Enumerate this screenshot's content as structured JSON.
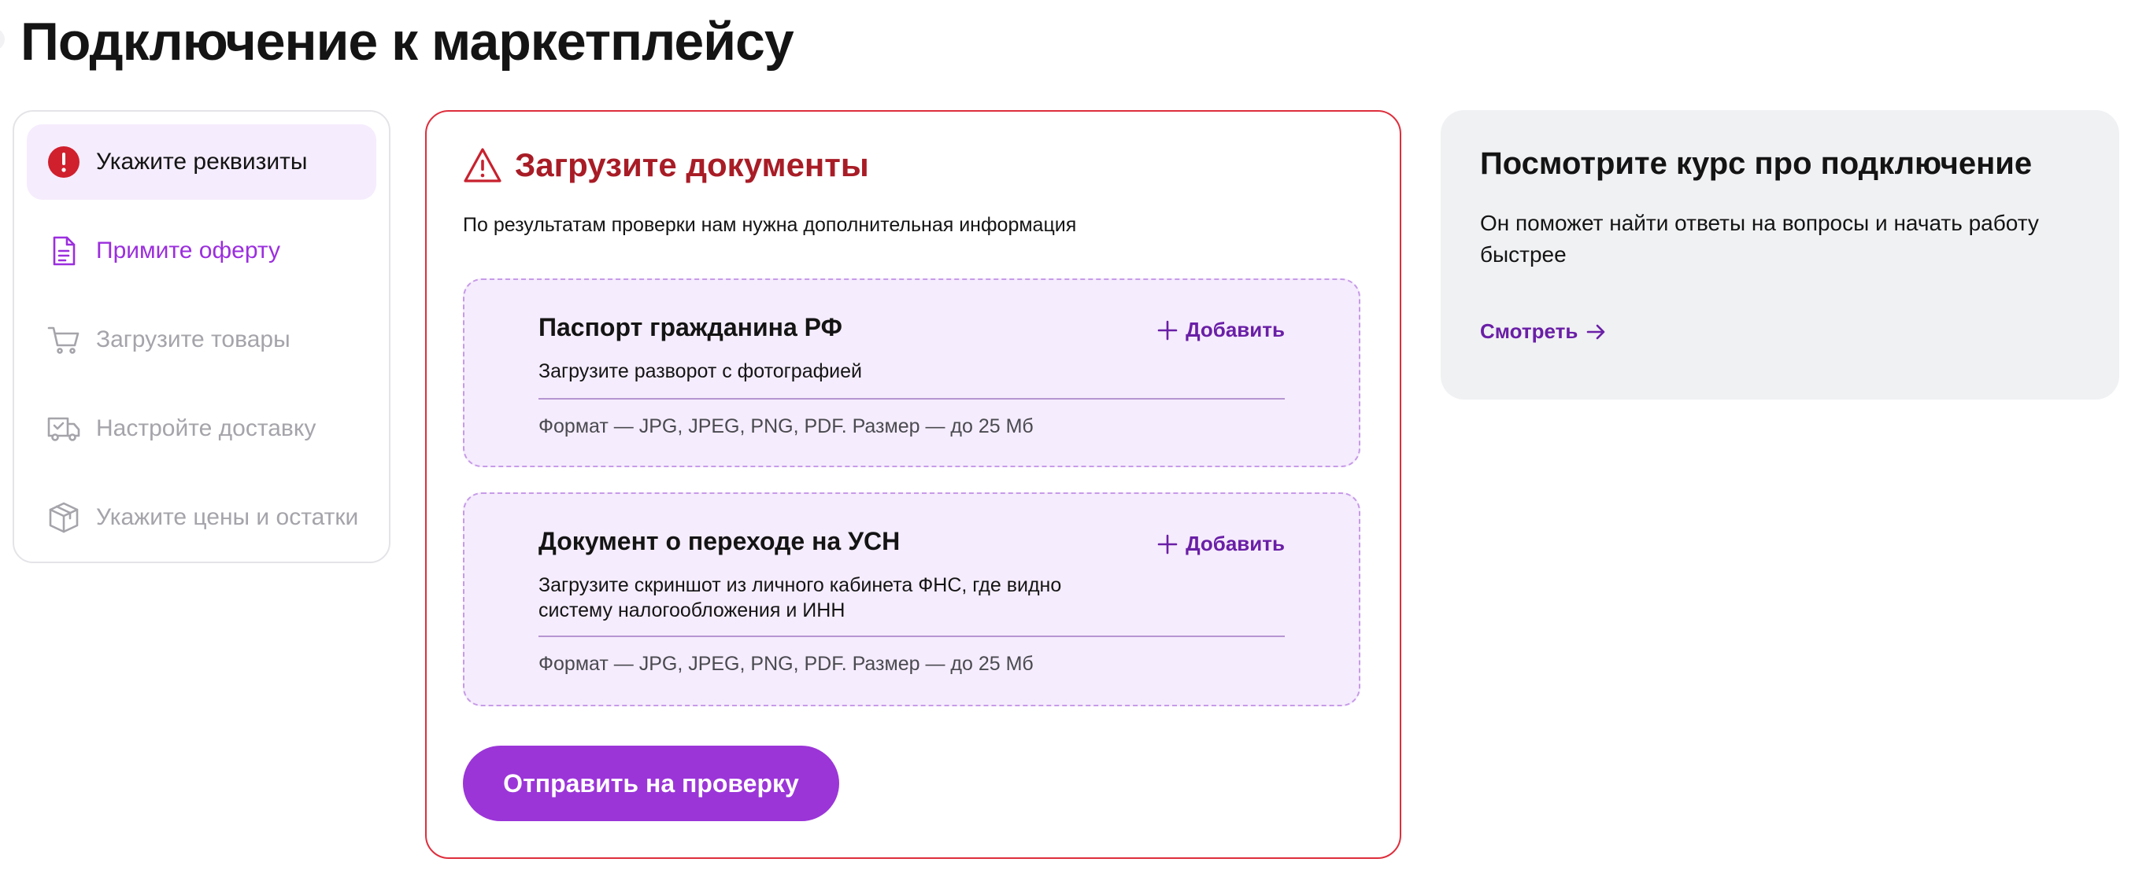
{
  "page": {
    "title": "Подключение к маркетплейсу"
  },
  "steps": [
    {
      "label": "Укажите реквизиты",
      "state": "error",
      "icon": "error-icon"
    },
    {
      "label": "Примите оферту",
      "state": "current",
      "icon": "document-icon"
    },
    {
      "label": "Загрузите товары",
      "state": "disabled",
      "icon": "cart-icon"
    },
    {
      "label": "Настройте доставку",
      "state": "disabled",
      "icon": "truck-icon"
    },
    {
      "label": "Укажите цены и остатки",
      "state": "disabled",
      "icon": "box-icon"
    }
  ],
  "main": {
    "title": "Загрузите документы",
    "subtitle": "По результатам проверки нам нужна дополнительная информация",
    "uploads": [
      {
        "title": "Паспорт гражданина РФ",
        "add_label": "Добавить",
        "description": "Загрузите разворот с фотографией",
        "format": "Формат — JPG, JPEG, PNG, PDF. Размер — до 25 Мб"
      },
      {
        "title": "Документ о переходе на УСН",
        "add_label": "Добавить",
        "description": "Загрузите скриншот из личного кабинета ФНС, где видно систему налогообложения и ИНН",
        "format": "Формат — JPG, JPEG, PNG, PDF. Размер — до 25 Мб"
      }
    ],
    "submit_label": "Отправить на проверку"
  },
  "course": {
    "title": "Посмотрите курс про подключение",
    "text": "Он поможет найти ответы на вопросы и начать работу быстрее",
    "link_label": "Смотреть"
  },
  "colors": {
    "accent": "#9b35d8",
    "link": "#6a1fa6",
    "error": "#de2e3c",
    "error_text": "#a81c26",
    "upload_bg": "#f5ecfd",
    "course_bg": "#f0f1f3"
  }
}
